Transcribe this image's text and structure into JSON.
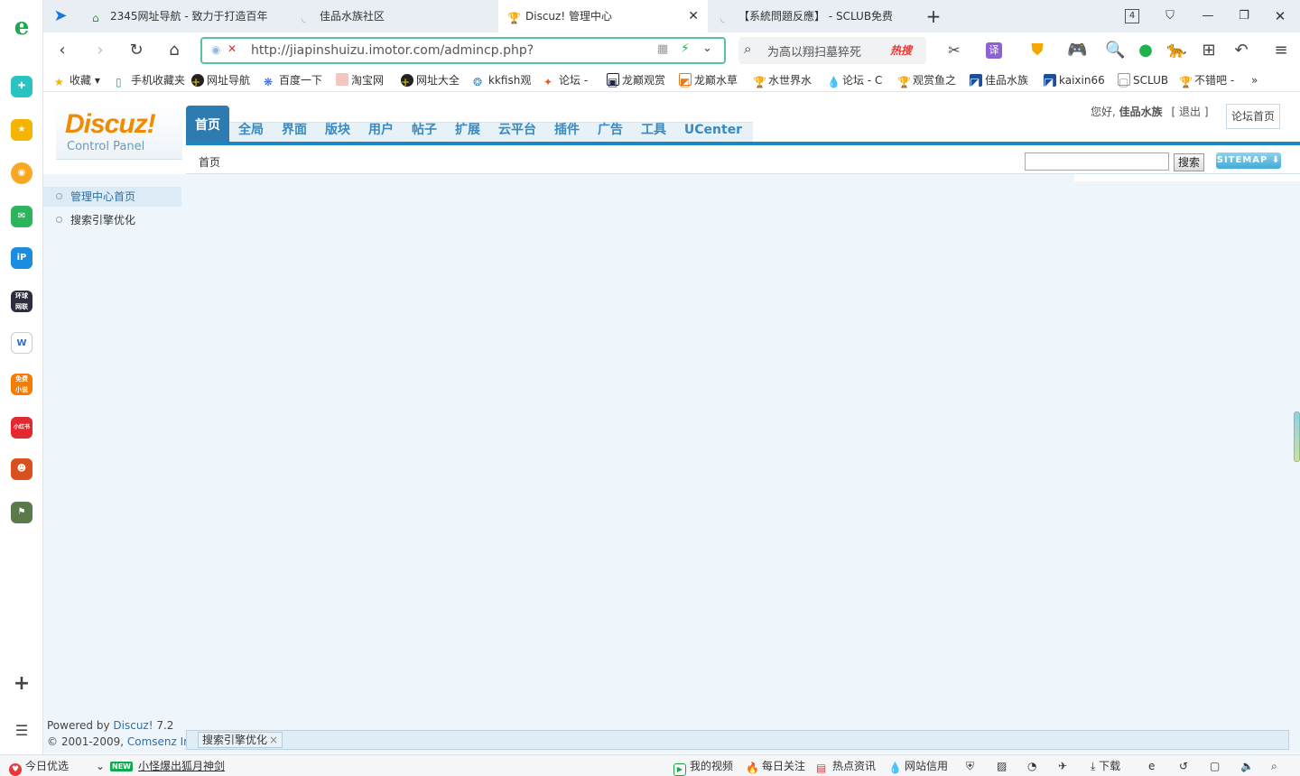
{
  "browser": {
    "tabs": [
      {
        "title": "2345网址导航 - 致力于打造百年"
      },
      {
        "title": "佳品水族社区"
      },
      {
        "title": "Discuz! 管理中心"
      },
      {
        "title": "【系統問題反應】 - SCLUB免费"
      }
    ],
    "active_tab_index": 2,
    "tab_count": "4",
    "url": "http://jiapinshuizu.imotor.com/admincp.php?",
    "search_placeholder": "为高以翔扫墓猝死",
    "hot_search_badge": "热搜",
    "bookmarks": [
      {
        "label": "收藏"
      },
      {
        "label": "手机收藏夹"
      },
      {
        "label": "网址导航"
      },
      {
        "label": "百度一下"
      },
      {
        "label": "淘宝网"
      },
      {
        "label": "网址大全"
      },
      {
        "label": "kkfish观"
      },
      {
        "label": "论坛 -"
      },
      {
        "label": "龙巅观赏"
      },
      {
        "label": "龙巅水草"
      },
      {
        "label": "水世界水"
      },
      {
        "label": "论坛 - C"
      },
      {
        "label": "观赏鱼之"
      },
      {
        "label": "佳品水族"
      },
      {
        "label": "kaixin66"
      },
      {
        "label": "SCLUB"
      },
      {
        "label": "不错吧 -"
      }
    ],
    "bookmarks_more": "»"
  },
  "admin": {
    "logo_main": "Discuz!",
    "logo_sub": "Control Panel",
    "menu": [
      {
        "label": "首页"
      },
      {
        "label": "全局"
      },
      {
        "label": "界面"
      },
      {
        "label": "版块"
      },
      {
        "label": "用户"
      },
      {
        "label": "帖子"
      },
      {
        "label": "扩展"
      },
      {
        "label": "云平台"
      },
      {
        "label": "插件"
      },
      {
        "label": "广告"
      },
      {
        "label": "工具"
      },
      {
        "label": "UCenter"
      }
    ],
    "active_menu_index": 0,
    "greeting": "您好,",
    "username": "佳品水族",
    "logout_label": "退出",
    "forum_home_label": "论坛首页",
    "breadcrumb": "首页",
    "search_button": "搜索",
    "sitemap_button": "SITEMAP",
    "sidebar": [
      {
        "label": "管理中心首页"
      },
      {
        "label": "搜索引擎优化"
      }
    ],
    "active_sidebar_index": 0,
    "footer": {
      "powered_prefix": "Powered by",
      "powered_link": "Discuz!",
      "version": "7.2",
      "copyright_prefix": "© 2001-2009,",
      "copyright_link": "Comsenz Inc."
    },
    "open_tab": "搜索引擎优化"
  },
  "statusbar": {
    "left_items": [
      {
        "label": "今日优选"
      },
      {
        "label": "NEW"
      },
      {
        "label": "小怪爆出狐月神剑"
      }
    ],
    "right_items": [
      {
        "label": "我的视频"
      },
      {
        "label": "每日关注"
      },
      {
        "label": "热点资讯"
      },
      {
        "label": "网站信用"
      },
      {
        "label": "下载"
      }
    ]
  },
  "colors": {
    "accent_blue": "#2e7bb1",
    "menu_text": "#3a8ac0",
    "logo_orange": "#f08a00",
    "url_border": "#55c49c",
    "page_bg": "#eef6fb"
  }
}
